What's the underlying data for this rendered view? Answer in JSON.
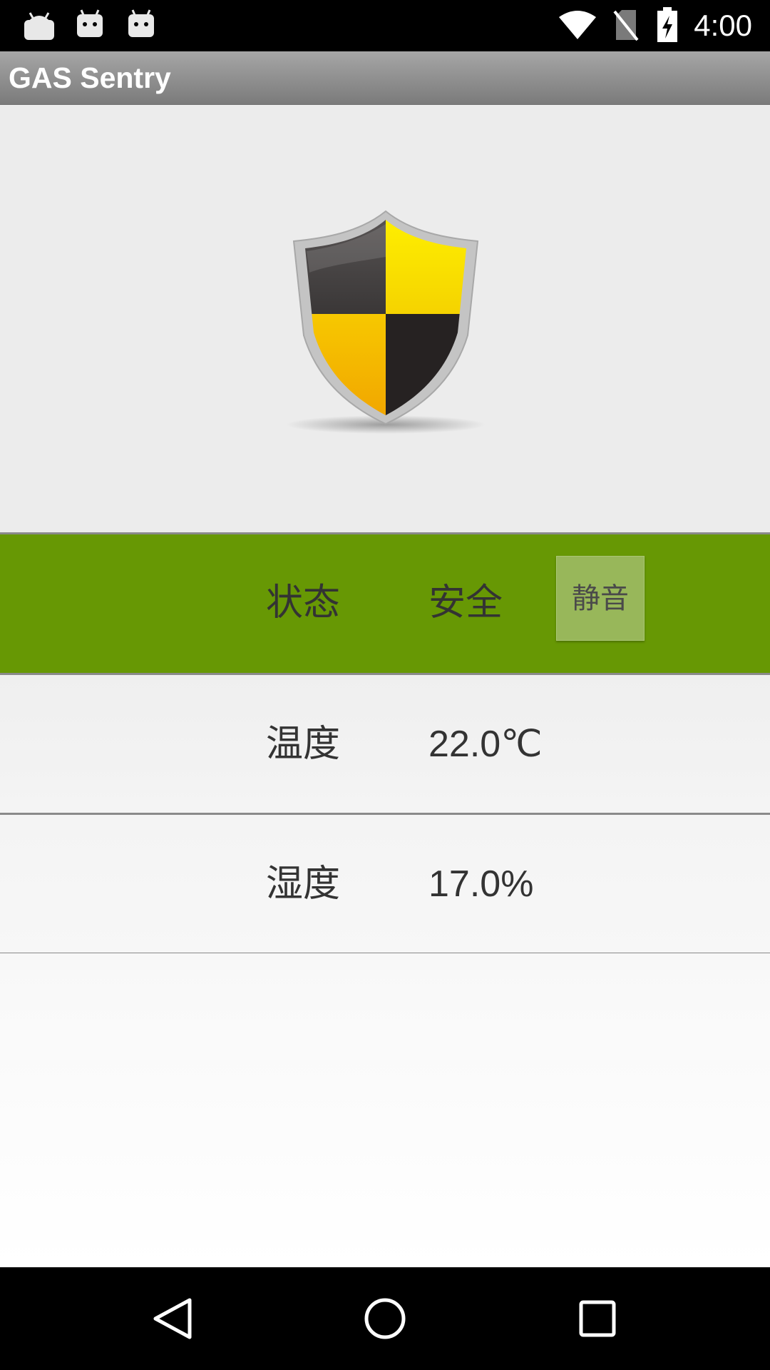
{
  "status_bar": {
    "time": "4:00",
    "notification_icons": [
      "android-icon",
      "android-icon",
      "android-icon"
    ],
    "system_icons": [
      "wifi-icon",
      "no-sim-icon",
      "battery-charging-icon"
    ]
  },
  "app": {
    "title": "GAS Sentry"
  },
  "hero": {
    "icon": "shield-icon",
    "colors": {
      "yellow": "#f5c400",
      "black": "#2b2828",
      "rim": "#bdbdbd"
    }
  },
  "readings": {
    "status": {
      "label": "状态",
      "value": "安全",
      "background": "#679804"
    },
    "mute_button": {
      "label": "静音"
    },
    "temperature": {
      "label": "温度",
      "value": "22.0℃"
    },
    "humidity": {
      "label": "湿度",
      "value": "17.0%"
    }
  },
  "nav_bar": {
    "buttons": [
      "back-icon",
      "home-icon",
      "recents-icon"
    ]
  }
}
